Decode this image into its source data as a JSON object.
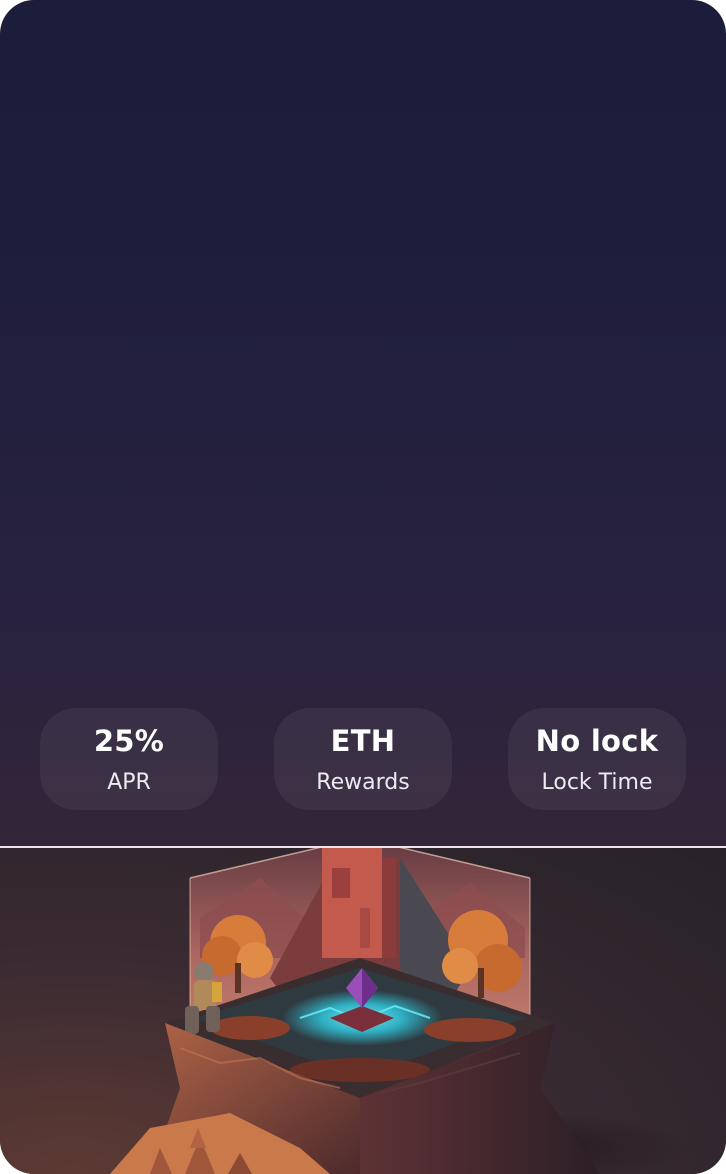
{
  "stats": [
    {
      "value": "25%",
      "label": "APR"
    },
    {
      "value": "ETH",
      "label": "Rewards"
    },
    {
      "value": "No lock",
      "label": "Lock Time"
    }
  ],
  "illustration": {
    "icon": "isometric-floating-island-illustration",
    "colors": {
      "sky": "#c9766c",
      "rock": "#8a4a3c",
      "tower": "#c45a4e",
      "foliage": "#d87c3b",
      "glow": "#35d6e6",
      "crystal": "#9a4fb8"
    }
  }
}
